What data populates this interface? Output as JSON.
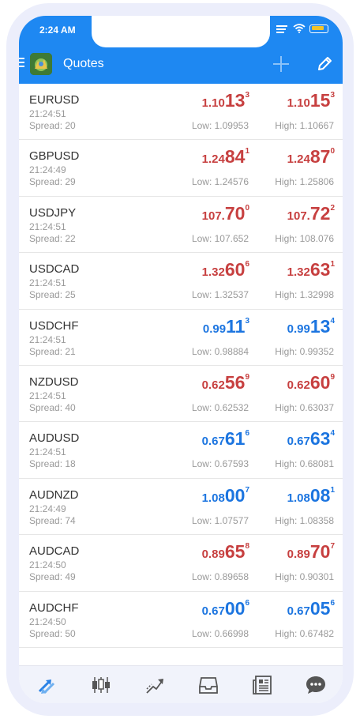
{
  "status_bar": {
    "time": "2:24 AM"
  },
  "app_bar": {
    "title": "Quotes"
  },
  "colors": {
    "accent": "#1e88f2",
    "down": "#c74040",
    "up": "#1c75e0"
  },
  "quotes": [
    {
      "symbol": "EURUSD",
      "time": "21:24:51",
      "spread": "Spread: 20",
      "direction": "down",
      "bid": {
        "small": "1.10",
        "big": "13",
        "sup": "3"
      },
      "ask": {
        "small": "1.10",
        "big": "15",
        "sup": "3"
      },
      "low": "Low: 1.09953",
      "high": "High: 1.10667"
    },
    {
      "symbol": "GBPUSD",
      "time": "21:24:49",
      "spread": "Spread: 29",
      "direction": "down",
      "bid": {
        "small": "1.24",
        "big": "84",
        "sup": "1"
      },
      "ask": {
        "small": "1.24",
        "big": "87",
        "sup": "0"
      },
      "low": "Low: 1.24576",
      "high": "High: 1.25806"
    },
    {
      "symbol": "USDJPY",
      "time": "21:24:51",
      "spread": "Spread: 22",
      "direction": "down",
      "bid": {
        "small": "107.",
        "big": "70",
        "sup": "0"
      },
      "ask": {
        "small": "107.",
        "big": "72",
        "sup": "2"
      },
      "low": "Low: 107.652",
      "high": "High: 108.076"
    },
    {
      "symbol": "USDCAD",
      "time": "21:24:51",
      "spread": "Spread: 25",
      "direction": "down",
      "bid": {
        "small": "1.32",
        "big": "60",
        "sup": "6"
      },
      "ask": {
        "small": "1.32",
        "big": "63",
        "sup": "1"
      },
      "low": "Low: 1.32537",
      "high": "High: 1.32998"
    },
    {
      "symbol": "USDCHF",
      "time": "21:24:51",
      "spread": "Spread: 21",
      "direction": "up",
      "bid": {
        "small": "0.99",
        "big": "11",
        "sup": "3"
      },
      "ask": {
        "small": "0.99",
        "big": "13",
        "sup": "4"
      },
      "low": "Low: 0.98884",
      "high": "High: 0.99352"
    },
    {
      "symbol": "NZDUSD",
      "time": "21:24:51",
      "spread": "Spread: 40",
      "direction": "down",
      "bid": {
        "small": "0.62",
        "big": "56",
        "sup": "9"
      },
      "ask": {
        "small": "0.62",
        "big": "60",
        "sup": "9"
      },
      "low": "Low: 0.62532",
      "high": "High: 0.63037"
    },
    {
      "symbol": "AUDUSD",
      "time": "21:24:51",
      "spread": "Spread: 18",
      "direction": "up",
      "bid": {
        "small": "0.67",
        "big": "61",
        "sup": "6"
      },
      "ask": {
        "small": "0.67",
        "big": "63",
        "sup": "4"
      },
      "low": "Low: 0.67593",
      "high": "High: 0.68081"
    },
    {
      "symbol": "AUDNZD",
      "time": "21:24:49",
      "spread": "Spread: 74",
      "direction": "up",
      "bid": {
        "small": "1.08",
        "big": "00",
        "sup": "7"
      },
      "ask": {
        "small": "1.08",
        "big": "08",
        "sup": "1"
      },
      "low": "Low: 1.07577",
      "high": "High: 1.08358"
    },
    {
      "symbol": "AUDCAD",
      "time": "21:24:50",
      "spread": "Spread: 49",
      "direction": "down",
      "bid": {
        "small": "0.89",
        "big": "65",
        "sup": "8"
      },
      "ask": {
        "small": "0.89",
        "big": "70",
        "sup": "7"
      },
      "low": "Low: 0.89658",
      "high": "High: 0.90301"
    },
    {
      "symbol": "AUDCHF",
      "time": "21:24:50",
      "spread": "Spread: 50",
      "direction": "up",
      "bid": {
        "small": "0.67",
        "big": "00",
        "sup": "6"
      },
      "ask": {
        "small": "0.67",
        "big": "05",
        "sup": "6"
      },
      "low": "Low: 0.66998",
      "high": "High: 0.67482"
    }
  ],
  "bottom_nav": [
    {
      "icon": "quotes-arrows-icon",
      "active": true
    },
    {
      "icon": "candlestick-chart-icon",
      "active": false
    },
    {
      "icon": "trade-icon",
      "active": false
    },
    {
      "icon": "history-inbox-icon",
      "active": false
    },
    {
      "icon": "news-icon",
      "active": false
    },
    {
      "icon": "chat-icon",
      "active": false
    }
  ]
}
